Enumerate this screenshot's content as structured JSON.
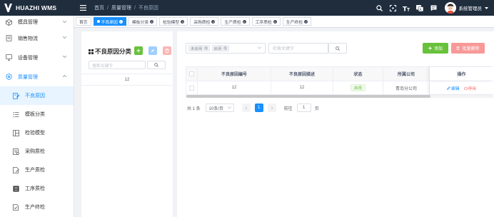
{
  "app": {
    "title": "HUAZHI WMS"
  },
  "breadcrumb": [
    "首页",
    "质量管理",
    "不良原因"
  ],
  "header": {
    "user_name": "系统管理员"
  },
  "sidebar": {
    "items": [
      {
        "label": "模具管理"
      },
      {
        "label": "销售物流"
      },
      {
        "label": "设备管理"
      },
      {
        "label": "质量管理"
      }
    ],
    "sub_items": [
      {
        "label": "不良原因"
      },
      {
        "label": "模板分类"
      },
      {
        "label": "检验模型"
      },
      {
        "label": "采购质检"
      },
      {
        "label": "生产质检"
      },
      {
        "label": "工序质检"
      },
      {
        "label": "生产终检"
      }
    ]
  },
  "tags": [
    {
      "label": "首页"
    },
    {
      "label": "不良原因"
    },
    {
      "label": "模板分类"
    },
    {
      "label": "检验模型"
    },
    {
      "label": "采购质检"
    },
    {
      "label": "生产质检"
    },
    {
      "label": "工序质检"
    },
    {
      "label": "生产终检"
    }
  ],
  "left_panel": {
    "title": "不良原因分类",
    "search_placeholder": "搜索关键字",
    "rows": [
      "12"
    ]
  },
  "toolbar": {
    "filter_chips": [
      "未启用",
      "启用"
    ],
    "keyword_placeholder": "检索关键字",
    "add_label": "添加",
    "batch_delete_label": "批量删除"
  },
  "table": {
    "columns": [
      "不良原因编号",
      "不良原因描述",
      "状态",
      "所属公司",
      "操作"
    ],
    "rows": [
      {
        "code": "12",
        "desc": "12",
        "status": "启用",
        "company": "青岛分公司",
        "edit": "编辑",
        "disable": "停用"
      }
    ]
  },
  "pagination": {
    "total": "共 1 条",
    "page_size": "10条/页",
    "current": "1",
    "goto_label": "前往",
    "goto_value": "1",
    "page_unit": "页"
  },
  "colors": {
    "header_bg": "#1f2d3d",
    "primary": "#1890ff",
    "success": "#67c23a",
    "danger_light": "#f89898",
    "danger": "#f56c6c"
  }
}
